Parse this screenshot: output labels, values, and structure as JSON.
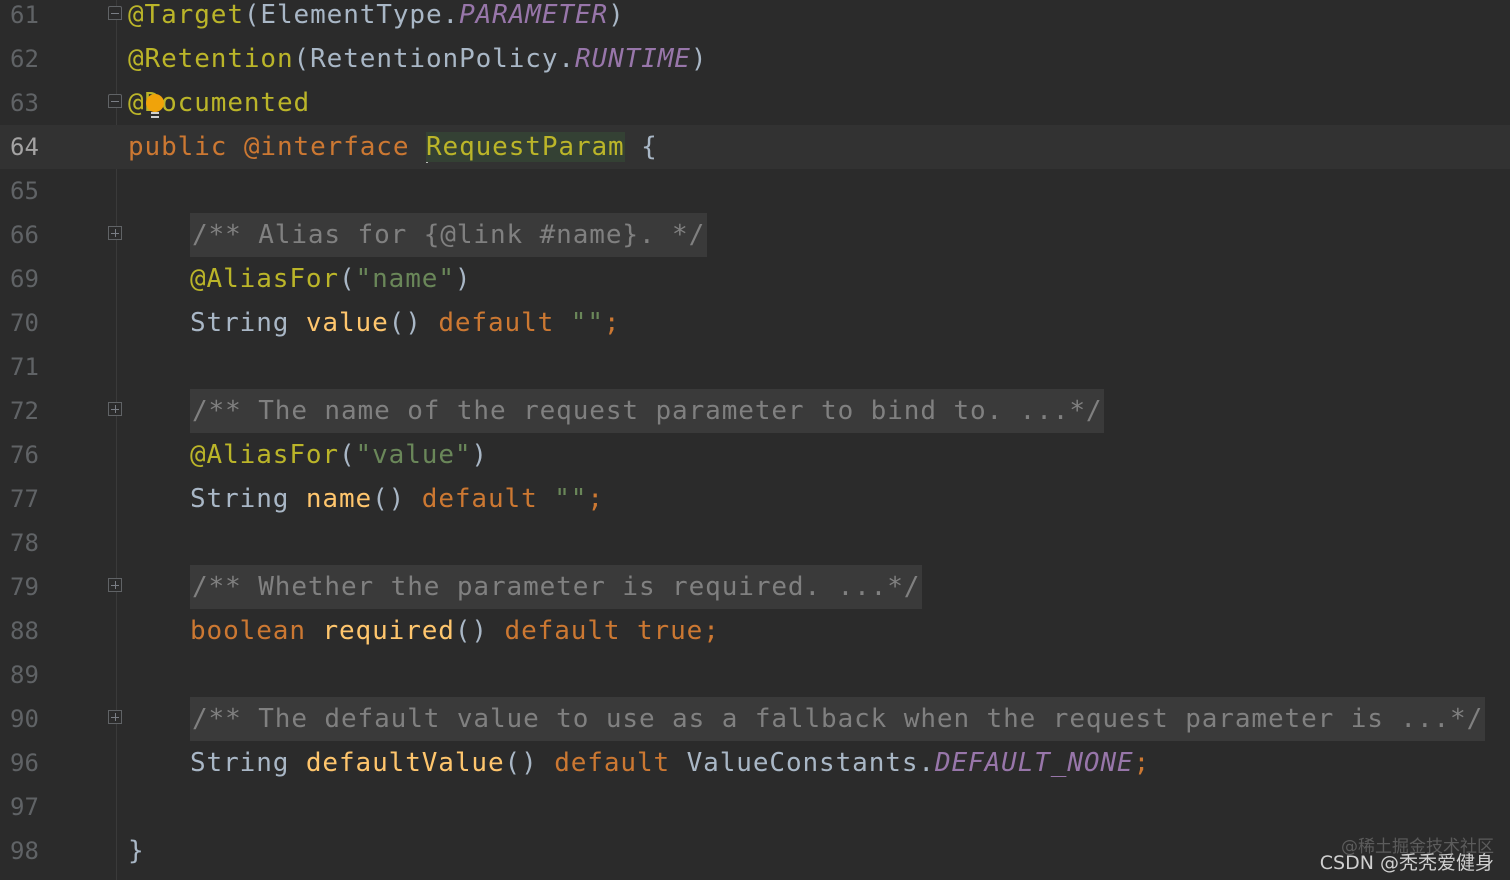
{
  "editor": {
    "lines": [
      {
        "num": "61",
        "tokens": [
          {
            "t": "@Target",
            "c": "ann"
          },
          {
            "t": "(ElementType.",
            "c": "plain"
          },
          {
            "t": "PARAMETER",
            "c": "const"
          },
          {
            "t": ")",
            "c": "plain"
          }
        ]
      },
      {
        "num": "62",
        "tokens": [
          {
            "t": "@Retention",
            "c": "ann"
          },
          {
            "t": "(RetentionPolicy.",
            "c": "plain"
          },
          {
            "t": "RUNTIME",
            "c": "const"
          },
          {
            "t": ")",
            "c": "plain"
          }
        ]
      },
      {
        "num": "63",
        "tokens": [
          {
            "t": "@Documented",
            "c": "ann"
          }
        ]
      },
      {
        "num": "64",
        "tokens": [
          {
            "t": "public ",
            "c": "kw"
          },
          {
            "t": "@interface ",
            "c": "kw"
          },
          {
            "t": "RequestParam",
            "c": "ann"
          },
          {
            "t": " {",
            "c": "plain"
          }
        ]
      },
      {
        "num": "65",
        "tokens": []
      },
      {
        "num": "66",
        "tokens": [
          {
            "t": "/** Alias for {@link #name}. */",
            "c": "cmt"
          }
        ]
      },
      {
        "num": "69",
        "tokens": [
          {
            "t": "@AliasFor",
            "c": "ann"
          },
          {
            "t": "(",
            "c": "plain"
          },
          {
            "t": "\"name\"",
            "c": "str"
          },
          {
            "t": ")",
            "c": "plain"
          }
        ]
      },
      {
        "num": "70",
        "tokens": [
          {
            "t": "String ",
            "c": "plain"
          },
          {
            "t": "value",
            "c": "fn"
          },
          {
            "t": "() ",
            "c": "plain"
          },
          {
            "t": "default ",
            "c": "kw"
          },
          {
            "t": "\"\"",
            "c": "str"
          },
          {
            "t": ";",
            "c": "kw"
          }
        ]
      },
      {
        "num": "71",
        "tokens": []
      },
      {
        "num": "72",
        "tokens": [
          {
            "t": "/** The name of the request parameter to bind to. ...*/",
            "c": "cmt"
          }
        ]
      },
      {
        "num": "76",
        "tokens": [
          {
            "t": "@AliasFor",
            "c": "ann"
          },
          {
            "t": "(",
            "c": "plain"
          },
          {
            "t": "\"value\"",
            "c": "str"
          },
          {
            "t": ")",
            "c": "plain"
          }
        ]
      },
      {
        "num": "77",
        "tokens": [
          {
            "t": "String ",
            "c": "plain"
          },
          {
            "t": "name",
            "c": "fn"
          },
          {
            "t": "() ",
            "c": "plain"
          },
          {
            "t": "default ",
            "c": "kw"
          },
          {
            "t": "\"\"",
            "c": "str"
          },
          {
            "t": ";",
            "c": "kw"
          }
        ]
      },
      {
        "num": "78",
        "tokens": []
      },
      {
        "num": "79",
        "tokens": [
          {
            "t": "/** Whether the parameter is required. ...*/",
            "c": "cmt"
          }
        ]
      },
      {
        "num": "88",
        "tokens": [
          {
            "t": "boolean ",
            "c": "kw"
          },
          {
            "t": "required",
            "c": "fn"
          },
          {
            "t": "() ",
            "c": "plain"
          },
          {
            "t": "default ",
            "c": "kw"
          },
          {
            "t": "true",
            "c": "kw"
          },
          {
            "t": ";",
            "c": "kw"
          }
        ]
      },
      {
        "num": "89",
        "tokens": []
      },
      {
        "num": "90",
        "tokens": [
          {
            "t": "/** The default value to use as a fallback when the request parameter is ...*/",
            "c": "cmt"
          }
        ]
      },
      {
        "num": "96",
        "tokens": [
          {
            "t": "String ",
            "c": "plain"
          },
          {
            "t": "defaultValue",
            "c": "fn"
          },
          {
            "t": "() ",
            "c": "plain"
          },
          {
            "t": "default ",
            "c": "kw"
          },
          {
            "t": "ValueConstants.",
            "c": "plain"
          },
          {
            "t": "DEFAULT_NONE",
            "c": "const"
          },
          {
            "t": ";",
            "c": "kw"
          }
        ]
      },
      {
        "num": "97",
        "tokens": []
      },
      {
        "num": "98",
        "tokens": [
          {
            "t": "}",
            "c": "plain"
          }
        ]
      }
    ]
  },
  "watermark": {
    "line1": "@稀土掘金技术社区",
    "line2": "CSDN @秃秃爱健身"
  },
  "colors": {
    "background": "#2b2b2b",
    "annotation": "#bbb529",
    "keyword": "#cc7832",
    "string": "#6a8759",
    "constant": "#9876aa",
    "method": "#ffc66d",
    "comment": "#808080",
    "text": "#a9b7c6"
  }
}
